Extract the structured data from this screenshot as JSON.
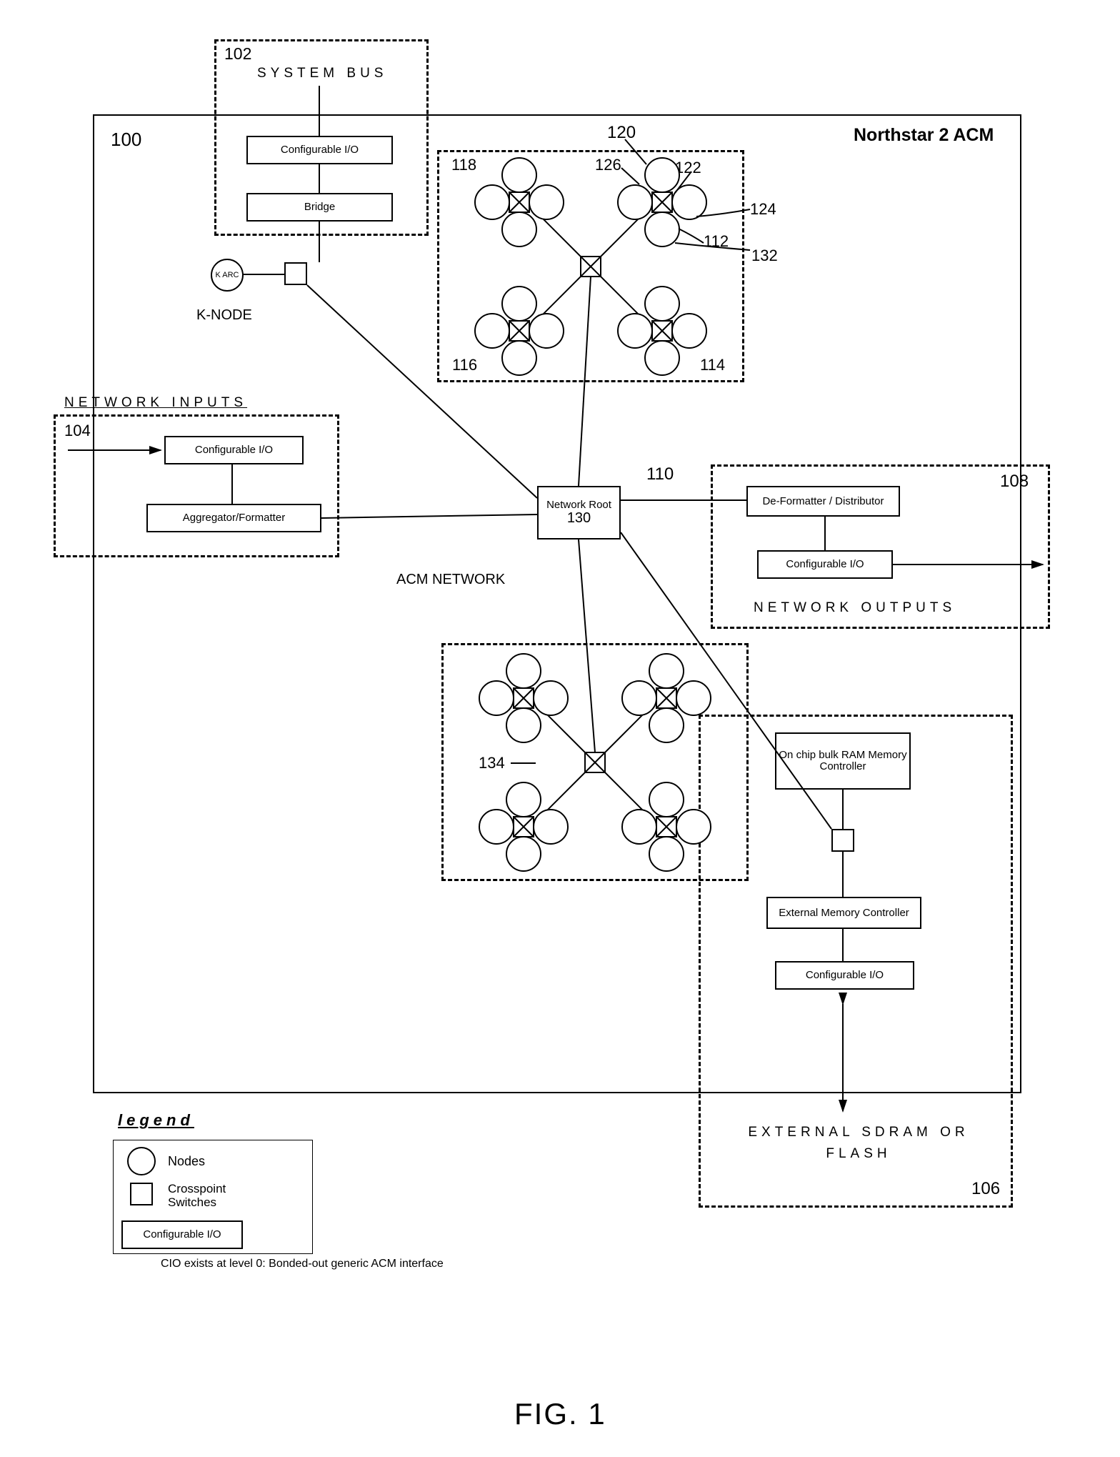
{
  "title": "Northstar 2 ACM",
  "figure": "FIG. 1",
  "refs": {
    "r100": "100",
    "r102": "102",
    "r104": "104",
    "r106": "106",
    "r108": "108",
    "r110": "110",
    "r112": "112",
    "r114": "114",
    "r116": "116",
    "r118": "118",
    "r120": "120",
    "r122": "122",
    "r124": "124",
    "r126": "126",
    "r130": "130",
    "r132": "132",
    "r134": "134"
  },
  "labels": {
    "system_bus": "SYSTEM BUS",
    "network_inputs": "NETWORK INPUTS",
    "network_outputs": "NETWORK OUTPUTS",
    "acm_network": "ACM NETWORK",
    "k_node": "K-NODE",
    "external_sdram": "EXTERNAL SDRAM OR FLASH",
    "legend": "legend",
    "nodes": "Nodes",
    "crosspoint": "Crosspoint Switches",
    "cio": "Configurable I/O",
    "cio_note": "CIO exists at level 0: Bonded-out generic ACM interface"
  },
  "boxes": {
    "configurable_io": "Configurable I/O",
    "bridge": "Bridge",
    "aggregator": "Aggregator/Formatter",
    "network_root": "Network Root",
    "deformatter": "De-Formatter / Distributor",
    "onchip_ram": "On chip bulk RAM Memory Controller",
    "ext_mem": "External Memory Controller",
    "k_arc": "K ARC"
  }
}
